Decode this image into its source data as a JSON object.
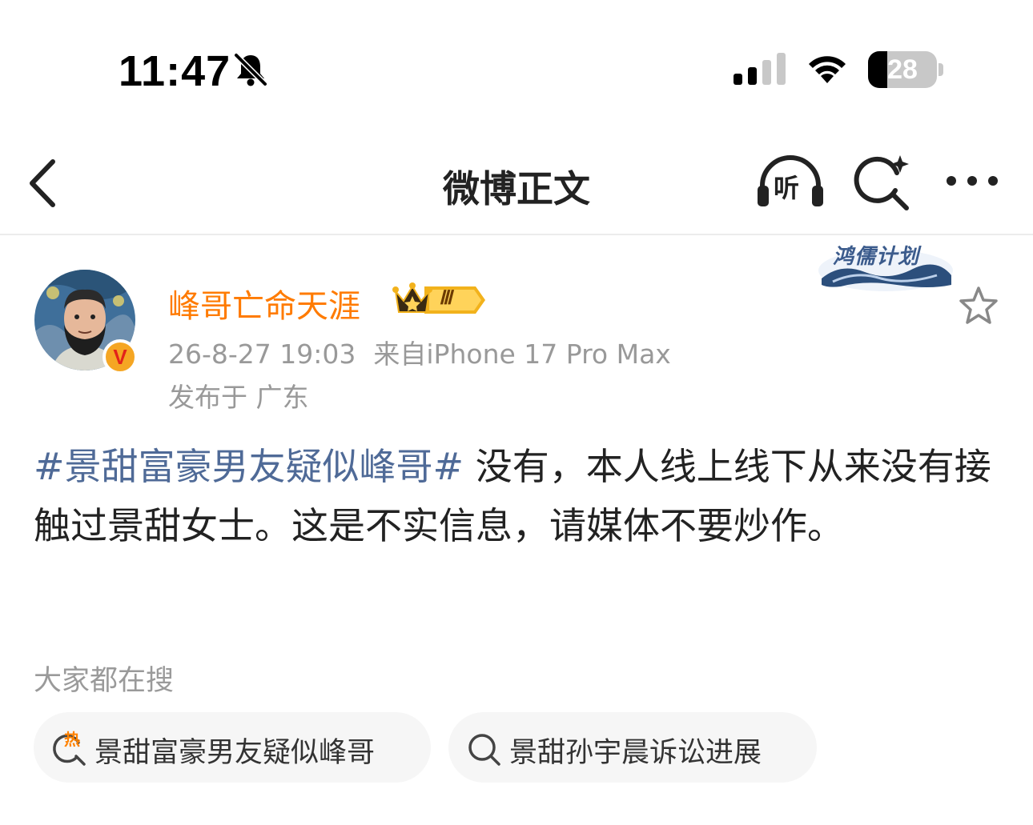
{
  "status_bar": {
    "time": "11:47",
    "battery_level": "28",
    "battery_fraction": 0.28,
    "icons": [
      "bell-muted-icon",
      "cellular-signal-icon",
      "wifi-icon",
      "battery-icon"
    ]
  },
  "nav": {
    "title": "微博正文",
    "listen_label": "听",
    "icons": [
      "back-chevron-icon",
      "headphones-icon",
      "search-sparkle-icon",
      "more-dots-icon"
    ]
  },
  "post": {
    "author": "峰哥亡命天涯",
    "rank_badge": "Ⅲ",
    "verified_letter": "V",
    "date": "26-8-27 19:03",
    "source": "来自iPhone 17 Pro Max",
    "location": "发布于 广东",
    "plan_badge": "鸿儒计划",
    "topic": "#景甜富豪男友疑似峰哥#",
    "body": " 没有，本人线上线下从来没有接触过景甜女士。这是不实信息，请媒体不要炒作。"
  },
  "search": {
    "hint": "大家都在搜",
    "hot_mark": "热",
    "suggestions": [
      {
        "label": "景甜富豪男友疑似峰哥",
        "icon": "hot-search-icon"
      },
      {
        "label": "景甜孙宇晨诉讼进展",
        "icon": "search-icon"
      }
    ]
  },
  "colors": {
    "author": "#ff7b00",
    "topic": "#4f6a97",
    "meta": "#999999",
    "chip_bg": "#f6f6f6"
  }
}
